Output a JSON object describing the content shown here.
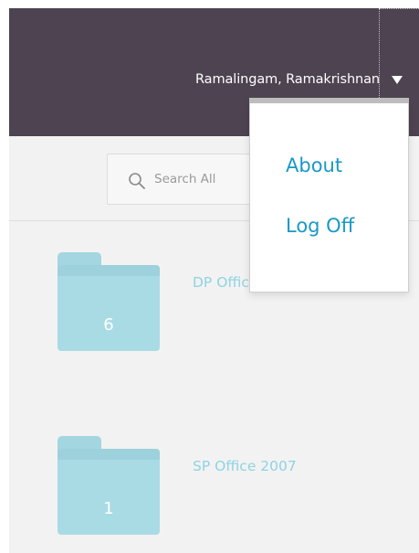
{
  "header": {
    "user_name": "Ramalingam, Ramakrishnan"
  },
  "search": {
    "placeholder": "Search All"
  },
  "folders": [
    {
      "count": "6",
      "title": "DP Office"
    },
    {
      "count": "1",
      "title": "SP Office 2007"
    }
  ],
  "user_menu": {
    "items": [
      {
        "label": "About"
      },
      {
        "label": "Log Off"
      }
    ]
  },
  "colors": {
    "header_bg": "#4e4351",
    "folder": "#a9dbe5",
    "link": "#1a98c8"
  }
}
